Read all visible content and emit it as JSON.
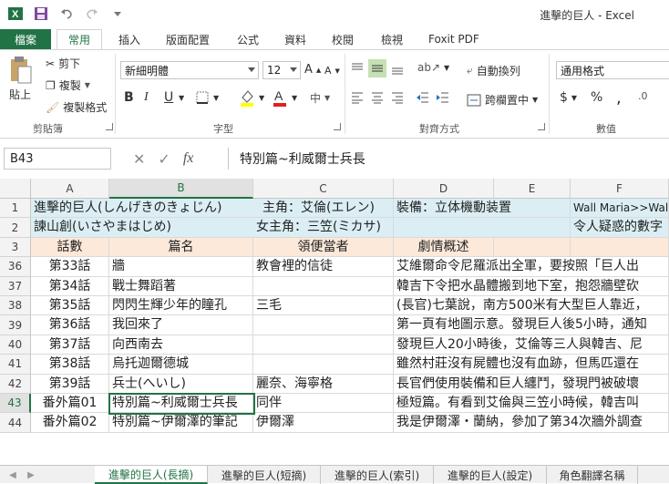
{
  "window": {
    "title": "進擊的巨人 - Excel"
  },
  "ribbon_tabs": {
    "file": "檔案",
    "home": "常用",
    "insert": "插入",
    "layout": "版面配置",
    "formulas": "公式",
    "data": "資料",
    "review": "校閱",
    "view": "檢視",
    "foxit": "Foxit PDF"
  },
  "clipboard": {
    "paste": "貼上",
    "cut": "剪下",
    "copy": "複製",
    "format_painter": "複製格式",
    "group": "剪貼簿"
  },
  "font": {
    "name": "新細明體",
    "size": "12",
    "bold": "B",
    "italic": "I",
    "underline": "U",
    "group": "字型",
    "grow": "A",
    "shrink": "A"
  },
  "alignment": {
    "wrap": "自動換列",
    "merge": "跨欄置中",
    "group": "對齊方式"
  },
  "number": {
    "format": "通用格式",
    "group": "數值",
    "currency": "$",
    "percent": "%",
    "comma": ","
  },
  "formula_bar": {
    "cell_ref": "B43",
    "content": "特別篇~利威爾士兵長",
    "fx": "fx"
  },
  "columns": [
    "A",
    "B",
    "C",
    "D",
    "E",
    "F"
  ],
  "rows": [
    {
      "num": "1",
      "a": "進擊的巨人(しんげきのきょじん)",
      "c": "主角：艾倫(エレン)",
      "d": "裝備：立体機動装置",
      "f": "Wall Maria>>Wall"
    },
    {
      "num": "2",
      "a": "諫山創(いさやまはじめ)",
      "c": "女主角：三笠(ミカサ)",
      "d": "",
      "f": "令人疑惑的數字"
    },
    {
      "num": "3",
      "a": "話數",
      "b": "篇名",
      "c": "領便當者",
      "d": "劇情概述"
    },
    {
      "num": "36",
      "a": "第33話",
      "b": "牆",
      "c": "教會裡的信徒",
      "d": "艾維爾命令尼羅派出全軍，要按照「巨人出"
    },
    {
      "num": "37",
      "a": "第34話",
      "b": "戰士舞蹈著",
      "c": "",
      "d": "韓吉下令把水晶體搬到地下室，抱怨牆壁砍"
    },
    {
      "num": "38",
      "a": "第35話",
      "b": "閃閃生輝少年的瞳孔",
      "c": "三毛",
      "d": "(長官)七葉說，南方500米有大型巨人靠近，"
    },
    {
      "num": "39",
      "a": "第36話",
      "b": "我回來了",
      "c": "",
      "d": "第一頁有地圖示意。發現巨人後5小時，通知"
    },
    {
      "num": "40",
      "a": "第37話",
      "b": "向西南去",
      "c": "",
      "d": "發現巨人20小時後，艾倫等三人與韓吉、尼"
    },
    {
      "num": "41",
      "a": "第38話",
      "b": "烏托迦爾德城",
      "c": "",
      "d": "雖然村莊沒有屍體也沒有血跡，但馬匹還在"
    },
    {
      "num": "42",
      "a": "第39話",
      "b": "兵士(へいし)",
      "c": "麗奈、海寧格",
      "d": "長官們使用裝備和巨人纏鬥，發現門被破壞"
    },
    {
      "num": "43",
      "a": "番外篇01",
      "b": "特別篇~利威爾士兵長",
      "c": "同伴",
      "d": "極短篇。有看到艾倫與三笠小時候，韓吉叫"
    },
    {
      "num": "44",
      "a": "番外篇02",
      "b": "特別篇~伊爾澤的筆記",
      "c": "伊爾澤",
      "d": "我是伊爾澤・蘭納，參加了第34次牆外調查"
    }
  ],
  "sheets": [
    "進擊的巨人(長摘)",
    "進擊的巨人(短摘)",
    "進擊的巨人(索引)",
    "進擊的巨人(設定)",
    "角色翻譯名稱"
  ],
  "colors": {
    "accent": "#217346",
    "header_blue": "#dbeef4",
    "header_peach": "#fde9d9"
  }
}
